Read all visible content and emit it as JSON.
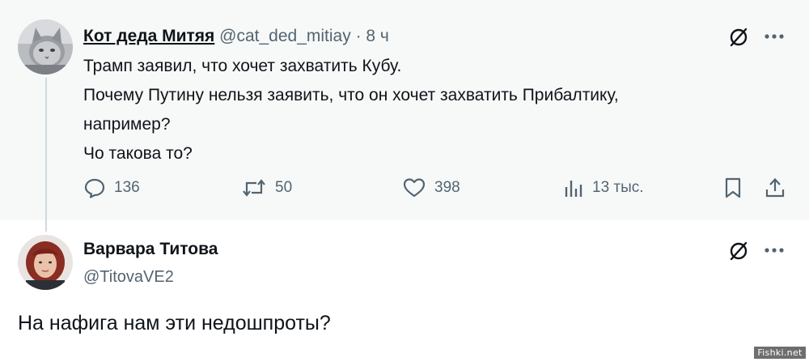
{
  "post1": {
    "display_name": "Кот деда Митяя",
    "handle": "@cat_ded_mitiay",
    "separator": "·",
    "time": "8 ч",
    "lines": [
      "Трамп заявил, что хочет захватить Кубу.",
      "Почему Путину нельзя заявить, что он хочет захватить Прибалтику,",
      "например?",
      "Чо такова то?"
    ],
    "actions": {
      "replies": "136",
      "reposts": "50",
      "likes": "398",
      "views": "13 тыс."
    }
  },
  "post2": {
    "display_name": "Варвара Титова",
    "handle": "@TitovaVE2",
    "text": "На нафига нам эти недошпроты?"
  },
  "watermark": "Fishki.net",
  "icons": {
    "grok": "grok-icon",
    "more": "more-icon",
    "reply": "reply-icon",
    "repost": "repost-icon",
    "like": "heart-icon",
    "views": "views-icon",
    "bookmark": "bookmark-icon",
    "share": "share-icon"
  },
  "colors": {
    "text": "#0f1419",
    "secondary": "#536471",
    "post_bg": "#f7f9f9",
    "thread_line": "#cfd9de"
  }
}
